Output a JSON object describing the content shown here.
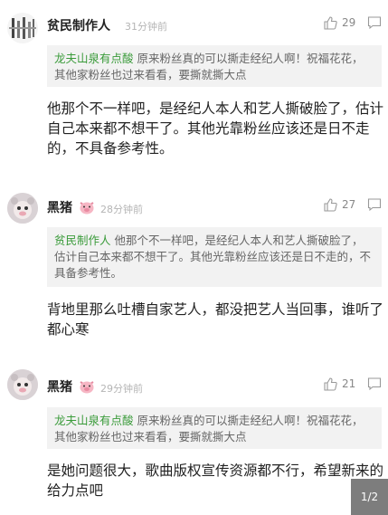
{
  "comments": [
    {
      "author": "贫民制作人",
      "time": "31分钟前",
      "likes": "29",
      "quote_author": "龙夫山泉有点酸",
      "quote_text": "原来粉丝真的可以撕走经纪人啊！祝福花花，其他家粉丝也过来看看，要撕就撕大点",
      "text": "他那个不一样吧，是经纪人本人和艺人撕破脸了，估计自己本来都不想干了。其他光靠粉丝应该还是日不走的，不具备参考性。"
    },
    {
      "author": "黑猪",
      "time": "28分钟前",
      "likes": "27",
      "quote_author": "贫民制作人",
      "quote_text": "他那个不一样吧，是经纪人本人和艺人撕破脸了，估计自己本来都不想干了。其他光靠粉丝应该还是日不走的，不具备参考性。",
      "text": "背地里那么吐槽自家艺人，都没把艺人当回事，谁听了都心寒"
    },
    {
      "author": "黑猪",
      "time": "29分钟前",
      "likes": "21",
      "quote_author": "龙夫山泉有点酸",
      "quote_text": "原来粉丝真的可以撕走经纪人啊！祝福花花，其他家粉丝也过来看看，要撕就撕大点",
      "text": "是她问题很大，歌曲版权宣传资源都不行，希望新来的给力点吧"
    }
  ],
  "page_indicator": "1/2",
  "icons": {
    "like": "thumbs-up-icon",
    "reply": "speech-bubble-icon",
    "pig": "pig-face-icon"
  },
  "colors": {
    "quote_author": "#3a9b3a",
    "meta_gray": "#b5b5b5",
    "quote_bg": "#f2f2f2",
    "page_badge_bg": "#7d7d7d"
  }
}
